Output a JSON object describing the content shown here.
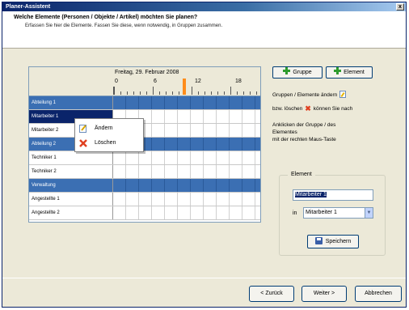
{
  "window": {
    "title": "Planer-Assistent",
    "close_label": "x"
  },
  "header": {
    "heading": "Welche Elemente (Personen / Objekte / Artikel) möchten Sie planen?",
    "subtext": "Erfassen Sie hier die Elemente.  Fassen Sie diese, wenn notwendig, in Gruppen zusammen."
  },
  "planner": {
    "date_label": "Freitag, 29. Februar 2008",
    "hours": [
      "0",
      "6",
      "12",
      "18"
    ],
    "rows": [
      {
        "label": "Abteilung 1",
        "type": "group"
      },
      {
        "label": "Mitarbeiter 1",
        "type": "selected"
      },
      {
        "label": "Mitarbeiter 2",
        "type": "item"
      },
      {
        "label": "Abteilung 2",
        "type": "group"
      },
      {
        "label": "Techniker 1",
        "type": "item"
      },
      {
        "label": "Techniker 2",
        "type": "item"
      },
      {
        "label": "Verwaltung",
        "type": "group"
      },
      {
        "label": "Angestellte 1",
        "type": "item"
      },
      {
        "label": "Angestellte 2",
        "type": "item"
      }
    ]
  },
  "context_menu": {
    "items": [
      {
        "label": "Ändern",
        "icon": "edit-icon"
      },
      {
        "label": "Löschen",
        "icon": "delete-icon"
      }
    ]
  },
  "toolbar": {
    "group_button": "Gruppe",
    "element_button": "Element"
  },
  "info": {
    "line1": "Gruppen / Elemente ändern",
    "line2a": "bzw. löschen",
    "line2b": "können Sie nach",
    "line3": "Anklicken der Gruppe / des",
    "line4": "Elementes",
    "line5": "mit der rechten Maus-Taste"
  },
  "element_box": {
    "title": "Element",
    "name_value": "Mitarbeiter 1",
    "in_label": "in",
    "parent_value": "Mitarbeiter 1",
    "save_button": "Speichern"
  },
  "footer": {
    "back_button": "< Zurück",
    "next_button": "Weiter >",
    "cancel_button": "Abbrechen"
  },
  "colors": {
    "group_row": "#3b6fb3",
    "selected_row": "#0a246a",
    "now_marker": "#ff8c1a"
  }
}
